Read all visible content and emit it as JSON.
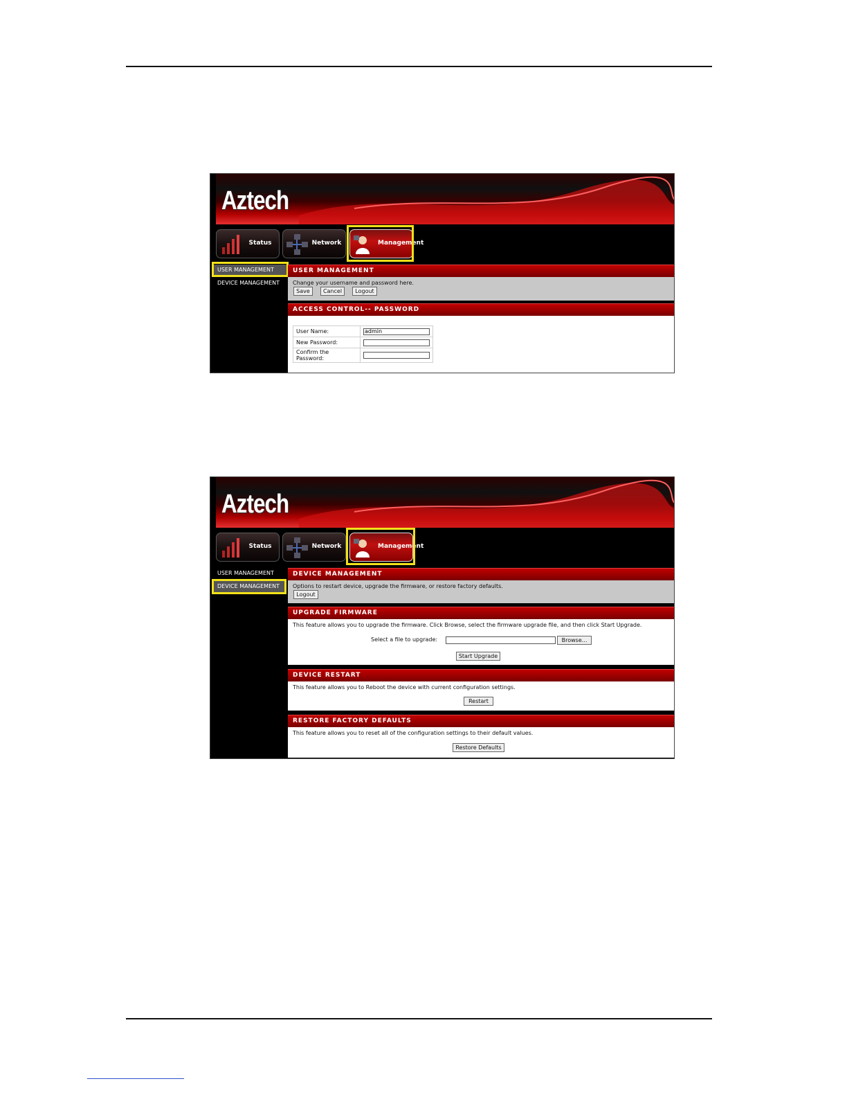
{
  "screenshot1": {
    "brand": "Aztech",
    "tabs": [
      "Status",
      "Network",
      "Management"
    ],
    "sidebar": [
      "USER MANAGEMENT",
      "DEVICE MANAGEMENT"
    ],
    "user_mgmt": {
      "title": "USER MANAGEMENT",
      "desc": "Change your username and password here.",
      "buttons": {
        "save": "Save",
        "cancel": "Cancel",
        "logout": "Logout"
      }
    },
    "access": {
      "title": "ACCESS CONTROL-- PASSWORD",
      "username_label": "User Name:",
      "username_value": "admin",
      "newpw_label": "New Password:",
      "confirm_label": "Confirm the Password:"
    }
  },
  "screenshot2": {
    "brand": "Aztech",
    "tabs": [
      "Status",
      "Network",
      "Management"
    ],
    "sidebar": [
      "USER MANAGEMENT",
      "DEVICE MANAGEMENT"
    ],
    "device_mgmt": {
      "title": "DEVICE MANAGEMENT",
      "desc": "Options to restart device, upgrade the firmware, or restore factory defaults.",
      "logout": "Logout"
    },
    "upgrade": {
      "title": "UPGRADE FIRMWARE",
      "desc": "This feature allows you to upgrade the firmware. Click Browse, select the firmware upgrade file, and then click Start Upgrade.",
      "file_label": "Select a file to upgrade:",
      "browse": "Browse...",
      "start": "Start Upgrade"
    },
    "restart": {
      "title": "DEVICE RESTART",
      "desc": "This feature allows you to Reboot the device with current configuration settings.",
      "button": "Restart"
    },
    "restore": {
      "title": "RESTORE FACTORY DEFAULTS",
      "desc": "This feature allows you to reset all of the configuration settings to their default values.",
      "button": "Restore Defaults"
    }
  },
  "colors": {
    "highlight": "#f2e11a",
    "header_red": "#b00000"
  }
}
